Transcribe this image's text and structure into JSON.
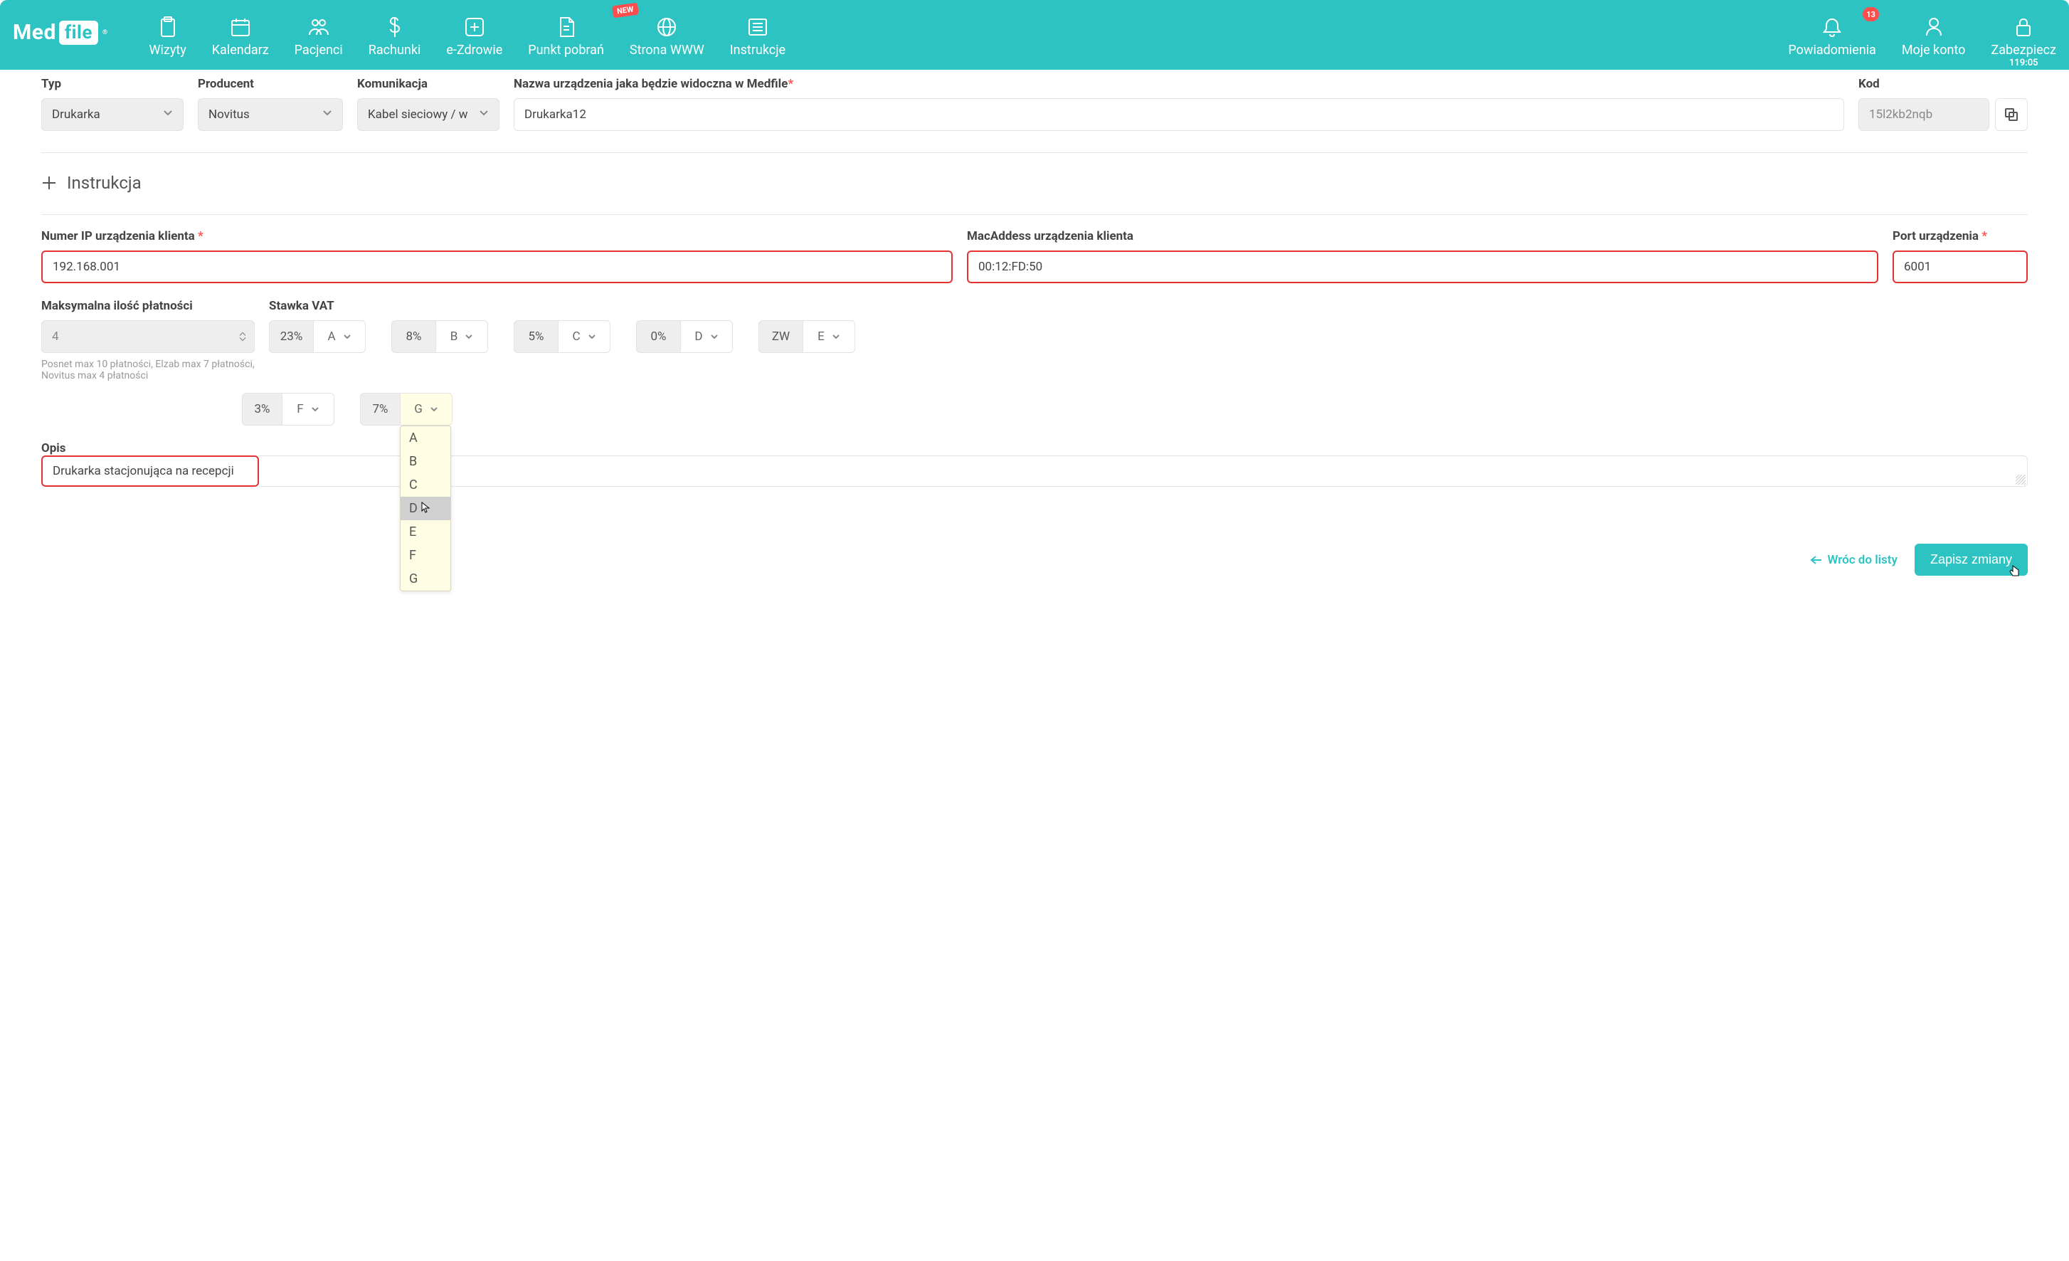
{
  "logo": {
    "med": "Med",
    "file": "file"
  },
  "nav": {
    "wizyty": "Wizyty",
    "kalendarz": "Kalendarz",
    "pacjenci": "Pacjenci",
    "rachunki": "Rachunki",
    "ezdrowie": "e-Zdrowie",
    "punkt": "Punkt pobrań",
    "strona": "Strona WWW",
    "strona_badge": "NEW",
    "instrukcje": "Instrukcje",
    "powiadomienia": "Powiadomienia",
    "powiadomienia_count": "13",
    "konto": "Moje konto",
    "zabezpiecz": "Zabezpiecz",
    "zabezpiecz_time": "119:05"
  },
  "fields": {
    "typ_label": "Typ",
    "typ_value": "Drukarka",
    "producent_label": "Producent",
    "producent_value": "Novitus",
    "komunikacja_label": "Komunikacja",
    "komunikacja_value": "Kabel sieciowy / w",
    "nazwa_label": "Nazwa urządzenia jaka będzie widoczna w Medfile",
    "nazwa_value": "Drukarka12",
    "kod_label": "Kod",
    "kod_value": "15l2kb2nqb"
  },
  "instrukcja": "Instrukcja",
  "net": {
    "ip_label": "Numer IP urządzenia klienta",
    "ip_value": "192.168.001",
    "mac_label": "MacAddess urządzenia klienta",
    "mac_value": "00:12:FD:50",
    "port_label": "Port urządzenia",
    "port_value": "6001"
  },
  "pay": {
    "max_label": "Maksymalna ilość płatności",
    "max_value": "4",
    "help": "Posnet max 10 płatności, Elzab max 7 płatności, Novitus max 4 płatności"
  },
  "vat": {
    "label": "Stawka VAT",
    "cells": [
      {
        "rate": "23%",
        "letter": "A"
      },
      {
        "rate": "8%",
        "letter": "B"
      },
      {
        "rate": "5%",
        "letter": "C"
      },
      {
        "rate": "0%",
        "letter": "D"
      },
      {
        "rate": "ZW",
        "letter": "E"
      },
      {
        "rate": "3%",
        "letter": "F"
      },
      {
        "rate": "7%",
        "letter": "G"
      }
    ],
    "dropdown": [
      "A",
      "B",
      "C",
      "D",
      "E",
      "F",
      "G"
    ]
  },
  "opis": {
    "label": "Opis",
    "value": "Drukarka stacjonująca na recepcji"
  },
  "footer": {
    "back": "Wróc do listy",
    "save": "Zapisz zmiany"
  }
}
